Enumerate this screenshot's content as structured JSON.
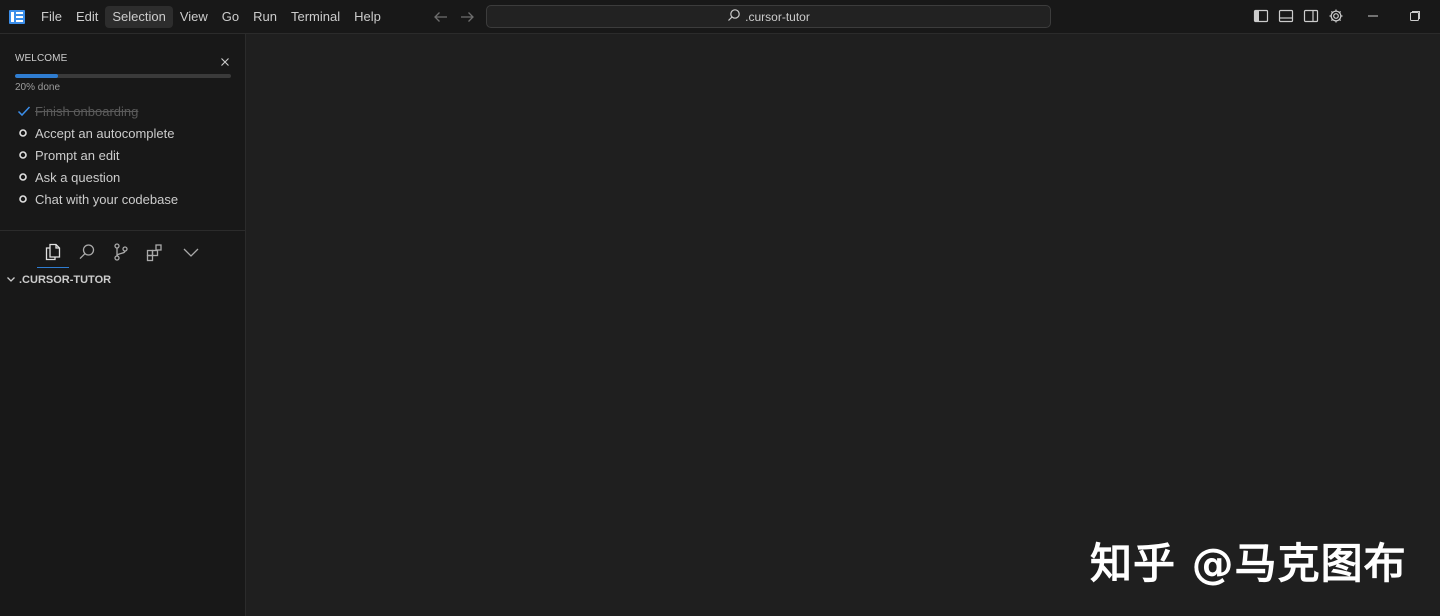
{
  "menu": {
    "items": [
      "File",
      "Edit",
      "Selection",
      "View",
      "Go",
      "Run",
      "Terminal",
      "Help"
    ],
    "active_index": 2
  },
  "command_center": {
    "text": ".cursor-tutor"
  },
  "icons": {
    "app_logo": "cursor-logo-icon",
    "back": "arrow-left-icon",
    "forward": "arrow-right-icon",
    "search": "search-icon",
    "layout": [
      "toggle-primary-sidebar-icon",
      "toggle-panel-icon",
      "toggle-secondary-sidebar-icon",
      "gear-icon"
    ],
    "window": [
      "minimize-icon",
      "restore-icon"
    ],
    "activity": [
      "files-icon",
      "search-icon",
      "source-control-icon",
      "extensions-icon",
      "chevron-down-icon"
    ]
  },
  "welcome": {
    "title": "WELCOME",
    "progress_percent": 20,
    "progress_text": "20% done",
    "tasks": [
      {
        "label": "Finish onboarding",
        "done": true
      },
      {
        "label": "Accept an autocomplete",
        "done": false
      },
      {
        "label": "Prompt an edit",
        "done": false
      },
      {
        "label": "Ask a question",
        "done": false
      },
      {
        "label": "Chat with your codebase",
        "done": false
      }
    ]
  },
  "explorer": {
    "folder_name": ".CURSOR-TUTOR"
  },
  "watermark": {
    "text": "知乎 @马克图布"
  },
  "colors": {
    "accent": "#2f7dd1",
    "titlebar_bg": "#181818",
    "editor_bg": "#1f1f1f",
    "sidebar_bg": "#181818"
  }
}
